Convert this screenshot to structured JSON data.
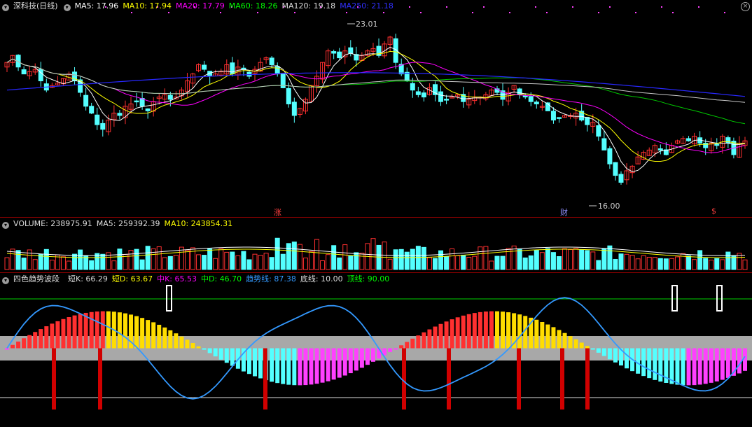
{
  "price_panel": {
    "title": "深科技(日线)",
    "ma_labels": [
      {
        "text": "MA5: 17.96",
        "color": "#ffffff"
      },
      {
        "text": "MA10: 17.94",
        "color": "#ffff00"
      },
      {
        "text": "MA20: 17.79",
        "color": "#ff00ff"
      },
      {
        "text": "MA60: 18.26",
        "color": "#00ff00"
      },
      {
        "text": "MA120: 19.18",
        "color": "#dddddd"
      },
      {
        "text": "MA250: 21.18",
        "color": "#3030ff"
      }
    ],
    "high_label": "23.01",
    "low_label": "16.00",
    "markers": [
      {
        "text": "涨",
        "color": "#ff4040"
      },
      {
        "text": "财",
        "color": "#9090ff"
      },
      {
        "text": "$",
        "color": "#ff4040"
      }
    ]
  },
  "volume_panel": {
    "labels": [
      {
        "text": "VOLUME: 238975.91",
        "color": "#dddddd"
      },
      {
        "text": "MA5: 259392.39",
        "color": "#dddddd"
      },
      {
        "text": "MA10: 243854.31",
        "color": "#ffff00"
      }
    ]
  },
  "indicator_panel": {
    "title": "四色趋势波段",
    "labels": [
      {
        "text": "短K: 66.29",
        "color": "#dddddd"
      },
      {
        "text": "短D: 63.67",
        "color": "#ffff00"
      },
      {
        "text": "中K: 65.53",
        "color": "#ff00ff"
      },
      {
        "text": "中D: 46.70",
        "color": "#00ff00"
      },
      {
        "text": "趋势线: 87.38",
        "color": "#3399ff"
      },
      {
        "text": "底线: 10.00",
        "color": "#dddddd"
      },
      {
        "text": "顶线: 90.00",
        "color": "#00ff00"
      }
    ]
  },
  "colors": {
    "up": "#ff3030",
    "down": "#54ffff",
    "ma5": "#ffffff",
    "ma10": "#ffff00",
    "ma20": "#ff00ff",
    "ma60": "#00c800",
    "ma120": "#c8c8c8",
    "ma250": "#2828ff",
    "trend": "#3399ff"
  },
  "chart_data": {
    "type": "candlestick",
    "price_range": [
      15.0,
      23.5
    ],
    "high": 23.01,
    "low": 16.0,
    "close_series": [
      21.4,
      21.7,
      21.2,
      20.9,
      21.0,
      21.1,
      20.6,
      20.2,
      20.4,
      20.5,
      20.7,
      20.9,
      20.6,
      20.1,
      19.5,
      19.2,
      18.7,
      18.5,
      18.9,
      19.2,
      19.1,
      19.5,
      19.6,
      19.7,
      19.5,
      19.3,
      19.7,
      19.9,
      20.0,
      19.8,
      19.9,
      20.2,
      20.6,
      20.9,
      21.3,
      21.1,
      20.8,
      20.9,
      21.0,
      21.3,
      20.9,
      21.2,
      21.1,
      20.8,
      21.1,
      21.4,
      21.6,
      21.3,
      20.9,
      20.3,
      19.6,
      19.1,
      19.4,
      19.8,
      20.4,
      20.8,
      21.4,
      21.9,
      21.8,
      21.6,
      21.9,
      21.8,
      21.5,
      21.7,
      21.9,
      22.0,
      21.7,
      22.2,
      22.5,
      21.4,
      20.9,
      20.6,
      20.2,
      20.0,
      19.9,
      20.3,
      20.0,
      19.7,
      19.8,
      19.9,
      20.0,
      19.7,
      19.8,
      19.9,
      19.9,
      20.0,
      20.2,
      20.1,
      19.8,
      20.1,
      20.4,
      20.0,
      19.9,
      19.7,
      19.6,
      19.5,
      19.3,
      18.9,
      19.0,
      19.1,
      19.1,
      19.2,
      18.9,
      18.7,
      18.8,
      18.2,
      17.6,
      17.0,
      16.5,
      16.2,
      16.7,
      16.9,
      17.3,
      17.5,
      17.6,
      17.8,
      17.6,
      17.4,
      17.8,
      18.0,
      18.1,
      18.0,
      18.2,
      17.9,
      17.7,
      17.9,
      17.8,
      18.2,
      17.9,
      17.4,
      17.9,
      18.0
    ]
  }
}
